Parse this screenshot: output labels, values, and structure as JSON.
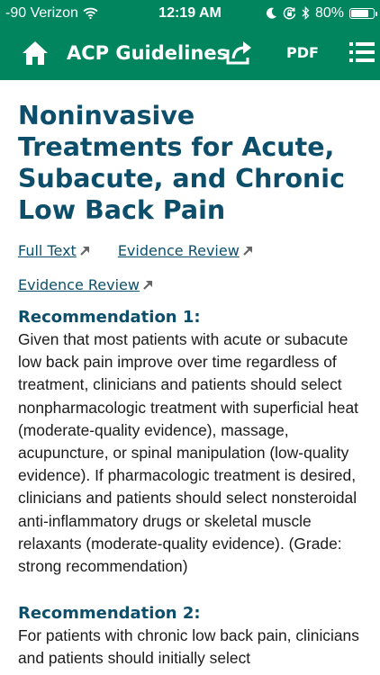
{
  "status_bar": {
    "carrier": "-90 Verizon",
    "time": "12:19 AM",
    "battery_percent": "80%",
    "battery_level": 0.8
  },
  "nav": {
    "title": "ACP Guidelines",
    "pdf_label": "PDF",
    "icons": [
      "home-icon",
      "share-icon",
      "menu-icon"
    ]
  },
  "article": {
    "title": "Noninvasive Treatments for Acute, Subacute, and Chronic Low Back Pain",
    "links": [
      {
        "label": "Full Text"
      },
      {
        "label": "Evidence Review"
      },
      {
        "label": "Evidence Review"
      }
    ],
    "recommendations": [
      {
        "heading": "Recommendation 1:",
        "text": "Given that most patients with acute or subacute low back pain improve over time regardless of treatment, clinicians and patients should select nonpharmacologic treatment with superficial heat (moderate-quality evidence), massage, acupuncture, or spinal manipulation (low-quality evidence). If pharmacologic treatment is desired, clinicians and patients should select nonsteroidal anti-inflammatory drugs or skeletal muscle relaxants (moderate-quality evidence). (Grade: strong recommendation)"
      },
      {
        "heading": "Recommendation 2:",
        "text": "For patients with chronic low back pain, clinicians and patients should initially select nonpharmacologic treatment with exercise"
      }
    ]
  },
  "colors": {
    "header_green": "#00855f",
    "title_blue": "#0d4f6b",
    "body_text": "#1b1b1b",
    "arrow_gray": "#666666"
  }
}
